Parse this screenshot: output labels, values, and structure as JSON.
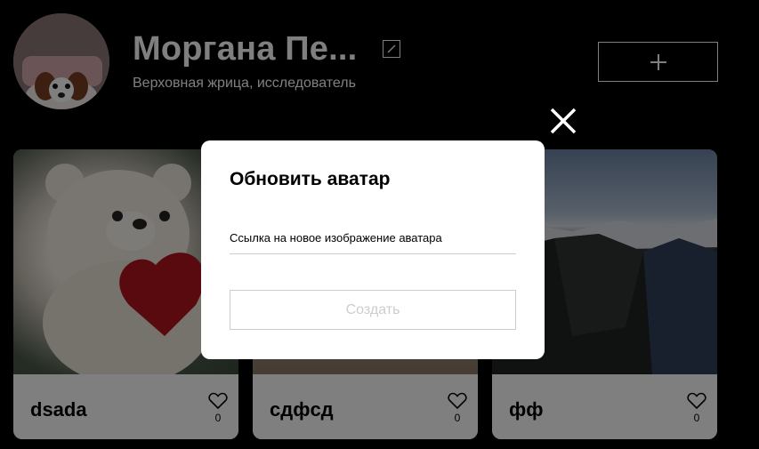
{
  "profile": {
    "name": "Моргана Пе...",
    "about": "Верховная жрица, исследователь",
    "avatar_icon": "puppy-photo"
  },
  "header": {
    "edit_icon": "pencil-icon",
    "add_icon": "plus-icon"
  },
  "cards": [
    {
      "title": "dsada",
      "likes": "0",
      "image": "teddy-bear-with-heart"
    },
    {
      "title": "сдфсд",
      "likes": "0",
      "image": "photo"
    },
    {
      "title": "фф",
      "likes": "0",
      "image": "mountain-landscape"
    }
  ],
  "popup": {
    "title": "Обновить аватар",
    "input_placeholder": "Ссылка на новое изображение аватара",
    "input_value": "",
    "submit_label": "Создать",
    "close_icon": "close-icon"
  },
  "colors": {
    "background": "#000000",
    "popup_background": "#ffffff",
    "overlay": "rgba(0,0,0,0.5)",
    "disabled_button": "rgba(0,0,0,0.2)"
  }
}
